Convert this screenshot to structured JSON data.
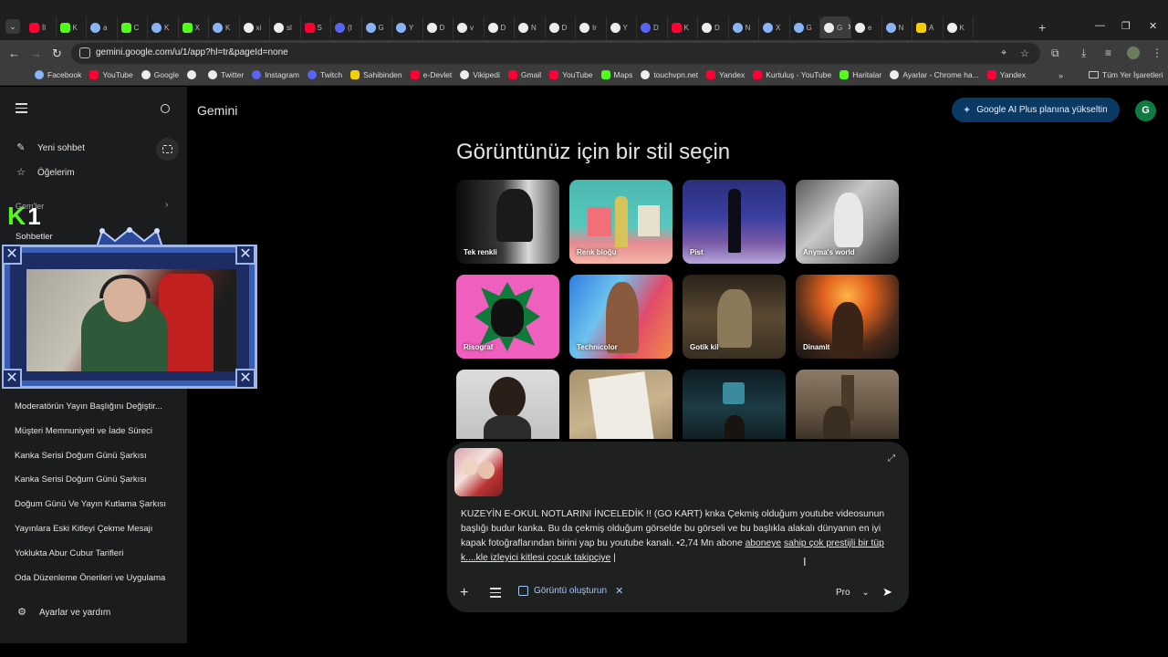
{
  "browser": {
    "tabs": [
      {
        "label": "İl",
        "fav": "red"
      },
      {
        "label": "K",
        "fav": "green"
      },
      {
        "label": "a",
        "fav": "blue"
      },
      {
        "label": "C",
        "fav": "green"
      },
      {
        "label": "K",
        "fav": "blue"
      },
      {
        "label": "X",
        "fav": "green"
      },
      {
        "label": "K",
        "fav": "blue"
      },
      {
        "label": "xi",
        "fav": "white"
      },
      {
        "label": "sl",
        "fav": "white"
      },
      {
        "label": "S",
        "fav": "red"
      },
      {
        "label": "(I",
        "fav": "purple"
      },
      {
        "label": "G",
        "fav": "blue"
      },
      {
        "label": "Y",
        "fav": "blue"
      },
      {
        "label": "D",
        "fav": "white"
      },
      {
        "label": "v",
        "fav": "white"
      },
      {
        "label": "D",
        "fav": "white"
      },
      {
        "label": "N",
        "fav": "white"
      },
      {
        "label": "D",
        "fav": "white"
      },
      {
        "label": "Ir",
        "fav": "white"
      },
      {
        "label": "Y",
        "fav": "white"
      },
      {
        "label": "D",
        "fav": "purple"
      },
      {
        "label": "K",
        "fav": "red"
      },
      {
        "label": "D",
        "fav": "white"
      },
      {
        "label": "N",
        "fav": "blue"
      },
      {
        "label": "X",
        "fav": "blue"
      },
      {
        "label": "G",
        "fav": "blue"
      },
      {
        "label": "G",
        "fav": "white",
        "active": true
      },
      {
        "label": "e",
        "fav": "white"
      },
      {
        "label": "N",
        "fav": "blue"
      },
      {
        "label": "A",
        "fav": "yellow"
      },
      {
        "label": "K",
        "fav": "white"
      }
    ],
    "url": "gemini.google.com/u/1/app?hl=tr&pageId=none",
    "bookmarks": [
      {
        "label": "Facebook",
        "fav": "blue"
      },
      {
        "label": "YouTube",
        "fav": "red"
      },
      {
        "label": "Google",
        "fav": "white"
      },
      {
        "label": "",
        "fav": "white"
      },
      {
        "label": "Twitter",
        "fav": "white"
      },
      {
        "label": "Instagram",
        "fav": "purple"
      },
      {
        "label": "Twitch",
        "fav": "purple"
      },
      {
        "label": "Sahibinden",
        "fav": "yellow"
      },
      {
        "label": "e-Devlet",
        "fav": "red"
      },
      {
        "label": "Vikipedi",
        "fav": "white"
      },
      {
        "label": "Gmail",
        "fav": "red"
      },
      {
        "label": "YouTube",
        "fav": "red"
      },
      {
        "label": "Maps",
        "fav": "green"
      },
      {
        "label": "touchvpn.net",
        "fav": "white"
      },
      {
        "label": "Yandex",
        "fav": "red"
      },
      {
        "label": "Kurtuluş - YouTube",
        "fav": "red"
      },
      {
        "label": "Haritalar",
        "fav": "green"
      },
      {
        "label": "Ayarlar - Chrome ha...",
        "fav": "white"
      },
      {
        "label": "Yandex",
        "fav": "red"
      }
    ],
    "all_bookmarks": "Tüm Yer İşaretleri"
  },
  "sidebar": {
    "new_chat": "Yeni sohbet",
    "my_items": "Öğelerim",
    "gems": "Gem'ler",
    "chats_title": "Sohbetler",
    "chats": [
      "Moderatörün Yayın Başlığını Değiştir...",
      "Müşteri Memnuniyeti ve İade Süreci",
      "Kanka Serisi Doğum Günü Şarkısı",
      "Kanka Serisi Doğum Günü Şarkısı",
      "Doğum Günü Ve Yayın Kutlama Şarkısı",
      "Yayınlara Eski Kitleyi Çekme Mesajı",
      "Yoklukta Abur Cubur Tarifleri",
      "Oda Düzenleme Önerileri ve Uygulama"
    ],
    "settings": "Ayarlar ve yardım"
  },
  "overlay": {
    "logo_letter": "K",
    "logo_number": "1"
  },
  "header": {
    "app_name": "Gemini",
    "upgrade": "Google AI Plus planına yükseltin",
    "avatar_letter": "G"
  },
  "main": {
    "heading": "Görüntünüz için bir stil seçin",
    "styles": [
      {
        "label": "Tek renkli"
      },
      {
        "label": "Renk bloğu"
      },
      {
        "label": "Pist"
      },
      {
        "label": "Anyma's world"
      },
      {
        "label": "Risograf"
      },
      {
        "label": "Technicolor"
      },
      {
        "label": "Gotik kil"
      },
      {
        "label": "Dinamit"
      },
      {
        "label": ""
      },
      {
        "label": ""
      },
      {
        "label": ""
      },
      {
        "label": ""
      }
    ]
  },
  "composer": {
    "prompt_part1": "KUZEYİN E-OKUL NOTLARINI İNCELEDİK !! (GO KART)  knka Çekmiş olduğum youtube videosunun başlığı budur kanka. Bu da çekmiş olduğum görselde bu görseli ve bu başlıkla alakalı dünyanın en iyi kapak fotoğraflarından birini yap bu youtube kanalı. •2,74 Mn abone ",
    "prompt_underlined1": "aboneye",
    "prompt_part2": " ",
    "prompt_underlined2": "sahip çok prestijli bir tüp k....kle izleyici kitlesi çocuk takipçiye",
    "prompt_part3": " |",
    "tool_chip": "Görüntü oluşturun",
    "model": "Pro"
  }
}
